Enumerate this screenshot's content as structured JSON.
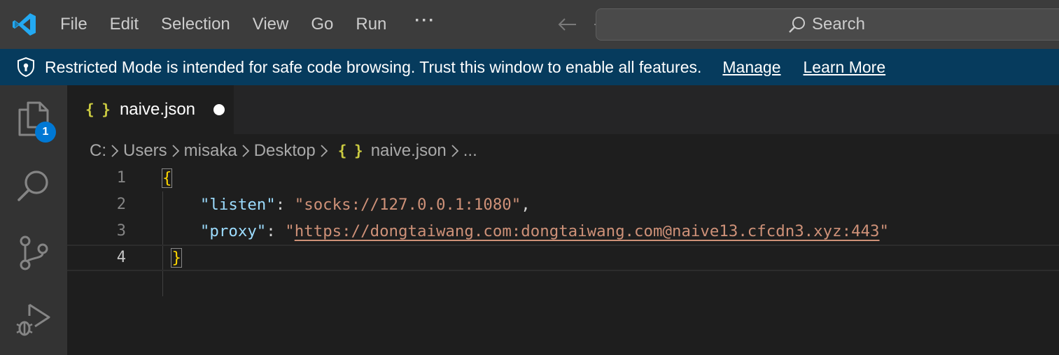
{
  "menu": {
    "items": [
      "File",
      "Edit",
      "Selection",
      "View",
      "Go",
      "Run"
    ],
    "more": "···"
  },
  "search": {
    "label": "Search"
  },
  "banner": {
    "message": "Restricted Mode is intended for safe code browsing. Trust this window to enable all features.",
    "manage": "Manage",
    "learn_more": "Learn More"
  },
  "activity": {
    "explorer_badge": "1"
  },
  "tab": {
    "icon": "{ }",
    "label": "naive.json",
    "dirty": true
  },
  "breadcrumb": {
    "items": [
      "C:",
      "Users",
      "misaka",
      "Desktop"
    ],
    "file": "naive.json",
    "trailing": "..."
  },
  "editor": {
    "line_numbers": [
      "1",
      "2",
      "3",
      "4"
    ],
    "active_line": "4",
    "open_brace": "{",
    "close_brace": "}",
    "listen_key": "\"listen\"",
    "listen_value": "\"socks://127.0.0.1:1080\"",
    "proxy_key": "\"proxy\"",
    "proxy_quote_open": "\"",
    "proxy_url": "https://dongtaiwang.com:dongtaiwang.com@naive13.cfcdn3.xyz:443",
    "proxy_quote_close": "\""
  },
  "colors": {
    "titlebar": "#3c3c3c",
    "banner": "#063b5d",
    "activitybar": "#333333",
    "editor_bg": "#1e1e1e",
    "json_key": "#9cdcfe",
    "json_string": "#ce9178",
    "bracket": "#ffd700",
    "badge": "#0078d4",
    "logo": "#23a9f2"
  }
}
